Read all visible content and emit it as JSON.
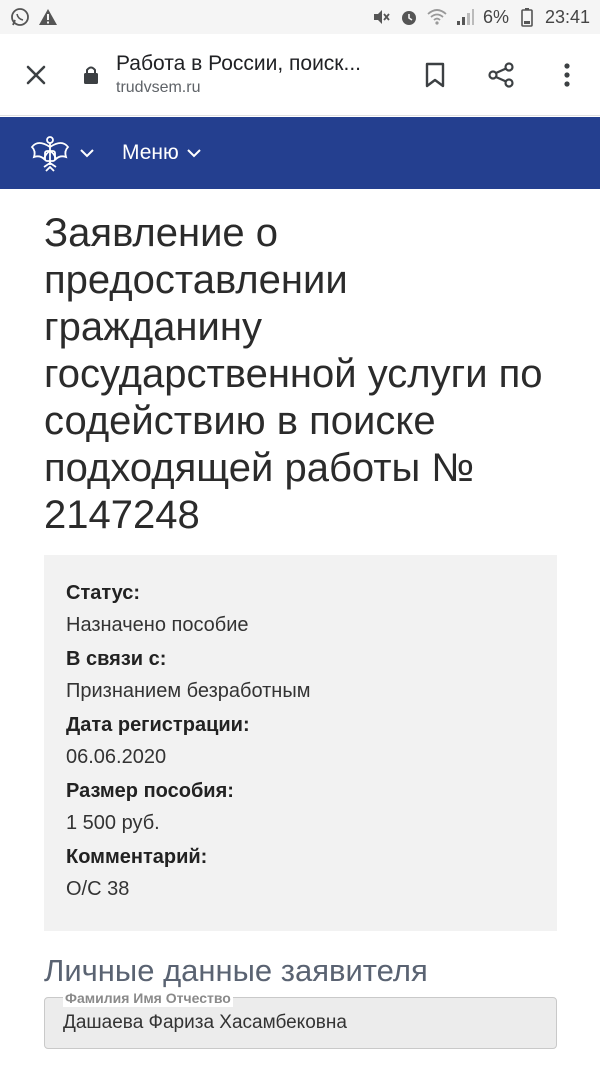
{
  "status_bar": {
    "battery": "6%",
    "time": "23:41"
  },
  "browser": {
    "page_title": "Работа в России, поиск...",
    "domain": "trudvsem.ru"
  },
  "site_header": {
    "menu_label": "Меню"
  },
  "main": {
    "heading": "Заявление о предоставлении гражданину государственной услуги по содействию в поиске подходящей работы № 2147248",
    "info": [
      {
        "label": "Статус:",
        "value": "Назначено пособие"
      },
      {
        "label": "В связи с:",
        "value": "Признанием безработным"
      },
      {
        "label": "Дата регистрации:",
        "value": "06.06.2020"
      },
      {
        "label": "Размер пособия:",
        "value": "1 500 руб."
      },
      {
        "label": "Комментарий:",
        "value": "О/С 38"
      }
    ],
    "section_title": "Личные данные заявителя",
    "fields": [
      {
        "label": "Фамилия Имя Отчество",
        "value": "Дашаева Фариза Хасамбековна"
      }
    ]
  },
  "colors": {
    "header_bg": "#243f8f",
    "card_bg": "#f2f2f2"
  }
}
